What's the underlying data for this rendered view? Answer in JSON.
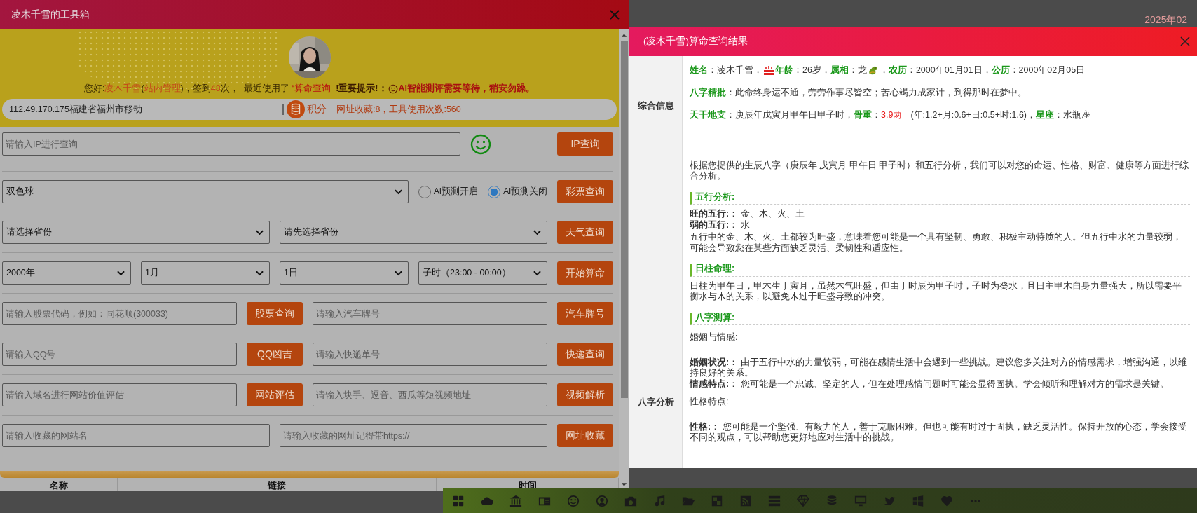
{
  "background_date": "2025年02",
  "left_window": {
    "title": "凌木千雪的工具箱",
    "greeting": [
      {
        "text": "您好:",
        "kind": "plain"
      },
      {
        "text": "凌木千雪",
        "kind": "highlight"
      },
      {
        "text": "(",
        "kind": "plain"
      },
      {
        "text": "站内管理",
        "kind": "highlight"
      },
      {
        "text": ")，签到",
        "kind": "plain"
      },
      {
        "text": "48",
        "kind": "highlight"
      },
      {
        "text": "次，  最近使用了 ",
        "kind": "plain"
      },
      {
        "text": "“算命查询",
        "kind": "recent"
      },
      {
        "text": "  !重要提示!：",
        "kind": "strong"
      }
    ],
    "notice": "Ai智能测评需要等待，稍安勿躁。",
    "info_bar": {
      "location": "112.49.170.175福建省福州市移动",
      "points_label": "积分",
      "stats": "网址收藏:8，工具使用次数:560"
    },
    "form_rows": [
      {
        "items": [
          {
            "kind": "input",
            "placeholder": "请输入IP进行查询"
          },
          {
            "kind": "smiley"
          },
          {
            "kind": "button",
            "label": "IP查询"
          }
        ]
      },
      {
        "items": [
          {
            "kind": "select",
            "value": "双色球"
          },
          {
            "kind": "radio",
            "label": "Ai预测开启",
            "selected": false
          },
          {
            "kind": "radio",
            "label": "Ai预测关闭",
            "selected": true
          },
          {
            "kind": "button",
            "label": "彩票查询"
          }
        ]
      },
      {
        "items": [
          {
            "kind": "select",
            "value": "请选择省份"
          },
          {
            "kind": "select",
            "value": "请先选择省份"
          },
          {
            "kind": "button",
            "label": "天气查询"
          }
        ]
      },
      {
        "items": [
          {
            "kind": "select",
            "value": "2000年"
          },
          {
            "kind": "select",
            "value": "1月"
          },
          {
            "kind": "select",
            "value": "1日"
          },
          {
            "kind": "select",
            "value": "子时（23:00 - 00:00）"
          },
          {
            "kind": "button",
            "label": "开始算命"
          }
        ]
      },
      {
        "items": [
          {
            "kind": "input",
            "placeholder": "请输入股票代码，例如：同花顺(300033)"
          },
          {
            "kind": "button",
            "label": "股票查询"
          },
          {
            "kind": "input",
            "placeholder": "请输入汽车牌号"
          },
          {
            "kind": "button",
            "label": "汽车牌号"
          }
        ]
      },
      {
        "items": [
          {
            "kind": "input",
            "placeholder": "请输入QQ号"
          },
          {
            "kind": "button",
            "label": "QQ凶吉"
          },
          {
            "kind": "input",
            "placeholder": "请输入快递单号"
          },
          {
            "kind": "button",
            "label": "快递查询"
          }
        ]
      },
      {
        "items": [
          {
            "kind": "input",
            "placeholder": "请输入域名进行网站价值评估"
          },
          {
            "kind": "button",
            "label": "网站评估"
          },
          {
            "kind": "input",
            "placeholder": "请输入块手、逗音、西瓜等短视频地址"
          },
          {
            "kind": "button",
            "label": "视频解析"
          }
        ]
      },
      {
        "items": [
          {
            "kind": "input",
            "placeholder": "请输入收藏的网站名"
          },
          {
            "kind": "input",
            "placeholder": "请输入收藏的网址记得带https://"
          },
          {
            "kind": "button",
            "label": "网址收藏"
          }
        ]
      }
    ],
    "table_columns": [
      "名称",
      "链接",
      "时间"
    ]
  },
  "result_window": {
    "title": "(凌木千雪)算命查询结果",
    "summary_label": "综合信息",
    "summary_lines": [
      [
        {
          "kind": "label",
          "text": "姓名"
        },
        {
          "kind": "text",
          "text": "：凌木千雪，"
        },
        {
          "kind": "cake_icon"
        },
        {
          "kind": "label",
          "text": "年龄"
        },
        {
          "kind": "text",
          "text": "：26岁，"
        },
        {
          "kind": "label",
          "text": "属相"
        },
        {
          "kind": "text",
          "text": "：龙"
        },
        {
          "kind": "dragon_icon"
        },
        {
          "kind": "label",
          "prefix": "，",
          "text": "农历"
        },
        {
          "kind": "text",
          "text": "：2000年01月01日，"
        },
        {
          "kind": "label",
          "text": "公历"
        },
        {
          "kind": "text",
          "text": "：2000年02月05日"
        }
      ],
      [
        {
          "kind": "label",
          "text": "八字精批"
        },
        {
          "kind": "text",
          "text": "：此命终身运不通，劳劳作事尽皆空；苦心竭力成家计，到得那时在梦中。"
        }
      ],
      [
        {
          "kind": "label",
          "text": "天干地支"
        },
        {
          "kind": "text",
          "text": "：庚辰年戊寅月甲午日甲子时，"
        },
        {
          "kind": "label",
          "text": "骨重"
        },
        {
          "kind": "text",
          "text": "："
        },
        {
          "kind": "value",
          "text": "3.9两"
        },
        {
          "kind": "text",
          "text": "(年:1.2+月:0.6+日:0.5+时:1.6)，"
        },
        {
          "kind": "label",
          "text": "星座"
        },
        {
          "kind": "text",
          "text": "：水瓶座"
        }
      ]
    ],
    "analysis_label": "八字分析",
    "analysis": [
      {
        "kind": "para",
        "text": "根据您提供的生辰八字（庚辰年 戊寅月 甲午日 甲子时）和五行分析，我们可以对您的命运、性格、财富、健康等方面进行综合分析。"
      },
      {
        "kind": "heading",
        "text": "五行分析:"
      },
      {
        "kind": "line",
        "text": "**旺的五行:**： 金、木、火、土"
      },
      {
        "kind": "line",
        "text": "**弱的五行:**： 水"
      },
      {
        "kind": "para",
        "text": "五行中的金、木、火、土都较为旺盛，意味着您可能是一个具有坚韧、勇敢、积极主动特质的人。但五行中水的力量较弱，可能会导致您在某些方面缺乏灵活、柔韧性和适应性。"
      },
      {
        "kind": "heading",
        "text": "日柱命理:"
      },
      {
        "kind": "para",
        "text": "日柱为甲午日，甲木生于寅月，虽然木气旺盛，但由于时辰为甲子时，子时为癸水，且日主甲木自身力量强大，所以需要平衡水与木的关系，以避免木过于旺盛导致的冲突。"
      },
      {
        "kind": "heading",
        "text": "八字测算:"
      },
      {
        "kind": "subhead",
        "text": "婚姻与情感:"
      },
      {
        "kind": "line",
        "text": "**婚姻状况:**： 由于五行中水的力量较弱，可能在感情生活中会遇到一些挑战。建议您多关注对方的情感需求，增强沟通，以维持良好的关系。"
      },
      {
        "kind": "line",
        "text": "**情感特点:**： 您可能是一个忠诚、坚定的人，但在处理感情问题时可能会显得固执。学会倾听和理解对方的需求是关键。"
      },
      {
        "kind": "subhead",
        "text": "性格特点:"
      },
      {
        "kind": "line",
        "text": "**性格:**： 您可能是一个坚强、有毅力的人，善于克服困难。但也可能有时过于固执，缺乏灵活性。保持开放的心态，学会接受不同的观点，可以帮助您更好地应对生活中的挑战。"
      }
    ]
  }
}
